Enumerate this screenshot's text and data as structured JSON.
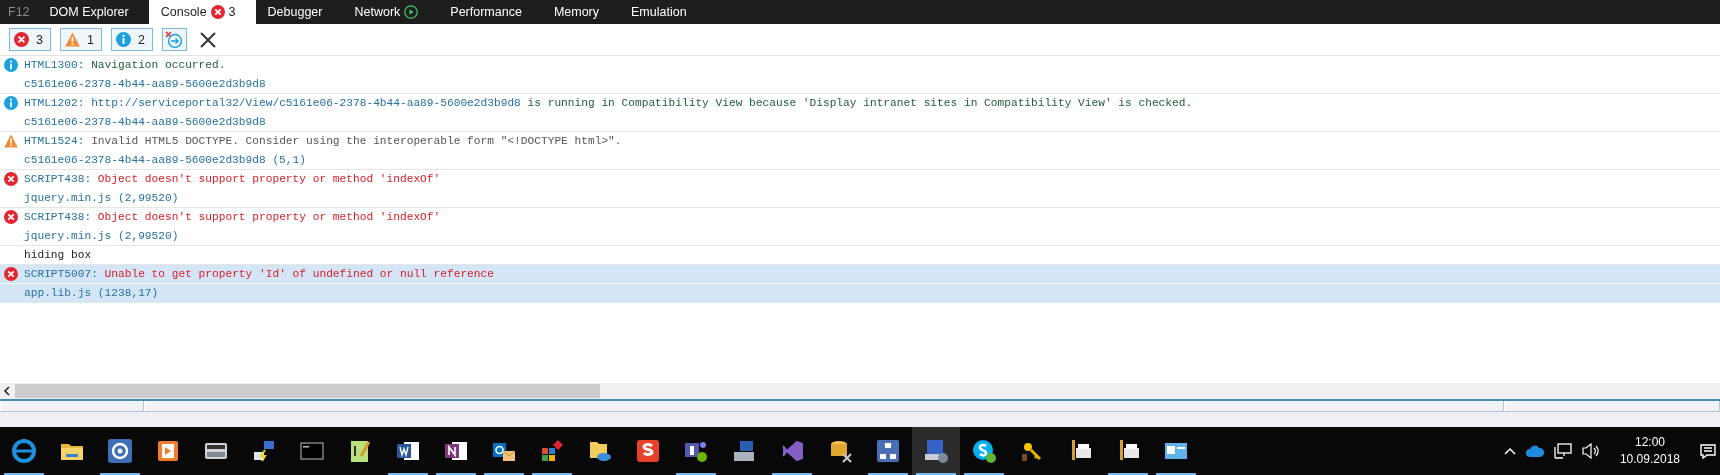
{
  "tabs": [
    {
      "label": "F12",
      "kind": "brand",
      "selected": false
    },
    {
      "label": "DOM Explorer",
      "kind": "plain",
      "selected": false
    },
    {
      "label": "Console",
      "kind": "errors",
      "badge": "3",
      "selected": true
    },
    {
      "label": "Debugger",
      "kind": "plain",
      "selected": false
    },
    {
      "label": "Network",
      "kind": "play",
      "selected": false
    },
    {
      "label": "Performance",
      "kind": "plain",
      "selected": false
    },
    {
      "label": "Memory",
      "kind": "plain",
      "selected": false
    },
    {
      "label": "Emulation",
      "kind": "plain",
      "selected": false
    }
  ],
  "filters": [
    {
      "kind": "error",
      "count": "3",
      "selected": true
    },
    {
      "kind": "warning",
      "count": "1",
      "selected": true
    },
    {
      "kind": "info",
      "count": "2",
      "selected": true
    }
  ],
  "clear_on_navigate": {
    "selected": true
  },
  "messages": [
    {
      "kind": "info",
      "code": "HTML1300:",
      "text": "Navigation occurred.",
      "source": "c5161e06-2378-4b44-aa89-5600e2d3b9d8",
      "selected": false
    },
    {
      "kind": "info",
      "code": "HTML1202:",
      "url": "http://serviceportal32/View/c5161e06-2378-4b44-aa89-5600e2d3b9d8",
      "text": "is running in Compatibility View because 'Display intranet sites in Compatibility View' is checked.",
      "source": "c5161e06-2378-4b44-aa89-5600e2d3b9d8",
      "selected": false
    },
    {
      "kind": "warning",
      "code": "HTML1524:",
      "text": "Invalid HTML5 DOCTYPE. Consider using the interoperable form \"<!DOCTYPE html>\".",
      "source": "c5161e06-2378-4b44-aa89-5600e2d3b9d8 (5,1)",
      "selected": false
    },
    {
      "kind": "error",
      "code": "SCRIPT438:",
      "text": "Object doesn't support property or method 'indexOf'",
      "source": "jquery.min.js (2,99520)",
      "selected": false
    },
    {
      "kind": "error",
      "code": "SCRIPT438:",
      "text": "Object doesn't support property or method 'indexOf'",
      "source": "jquery.min.js (2,99520)",
      "selected": false
    },
    {
      "kind": "log",
      "text": "hiding box",
      "selected": false
    },
    {
      "kind": "error",
      "code": "SCRIPT5007:",
      "text": "Unable to get property 'Id' of undefined or null reference",
      "source": "app.lib.js (1238,17)",
      "selected": true
    }
  ],
  "taskbar": [
    {
      "kind": "browser",
      "running": true,
      "selected": false
    },
    {
      "kind": "folder",
      "running": false,
      "selected": false
    },
    {
      "kind": "sync",
      "running": true,
      "selected": false
    },
    {
      "kind": "media",
      "running": false,
      "selected": false
    },
    {
      "kind": "scanner",
      "running": false,
      "selected": false
    },
    {
      "kind": "network",
      "running": false,
      "selected": false
    },
    {
      "kind": "terminal",
      "running": false,
      "selected": false
    },
    {
      "kind": "notepad",
      "running": false,
      "selected": false
    },
    {
      "kind": "word",
      "running": true,
      "selected": false
    },
    {
      "kind": "notebook",
      "running": true,
      "selected": false
    },
    {
      "kind": "mail",
      "running": true,
      "selected": false
    },
    {
      "kind": "tiles",
      "running": true,
      "selected": false
    },
    {
      "kind": "cloudfolder",
      "running": false,
      "selected": false
    },
    {
      "kind": "zigzag",
      "running": false,
      "selected": false
    },
    {
      "kind": "people",
      "running": true,
      "selected": false
    },
    {
      "kind": "computer",
      "running": false,
      "selected": false
    },
    {
      "kind": "loop",
      "running": true,
      "selected": false
    },
    {
      "kind": "database",
      "running": false,
      "selected": false
    },
    {
      "kind": "diagram",
      "running": true,
      "selected": false
    },
    {
      "kind": "monitor",
      "running": true,
      "selected": true
    },
    {
      "kind": "chat",
      "running": true,
      "selected": false
    },
    {
      "kind": "keys",
      "running": false,
      "selected": false
    },
    {
      "kind": "printer",
      "running": false,
      "selected": false
    },
    {
      "kind": "printer",
      "running": true,
      "selected": false
    },
    {
      "kind": "card",
      "running": true,
      "selected": false
    }
  ],
  "tray": {
    "time": "12:00",
    "date": "10.09.2018"
  }
}
